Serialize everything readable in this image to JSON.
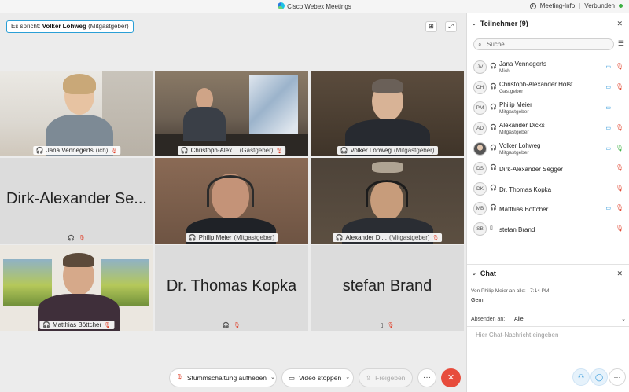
{
  "app": {
    "title": "Cisco Webex Meetings",
    "meeting_info": "Meeting-Info",
    "status": "Verbunden"
  },
  "stage": {
    "speaker_prefix": "Es spricht:",
    "speaker_name": "Volker Lohweg",
    "speaker_role": "(Mitgastgeber)"
  },
  "tiles": [
    {
      "name": "Jana Vennegerts",
      "role": "(ich)"
    },
    {
      "name": "Christoph-Alex...",
      "role": "(Gastgeber)"
    },
    {
      "name": "Volker Lohweg",
      "role": "(Mitgastgeber)"
    },
    {
      "big_name": "Dirk-Alexander Se..."
    },
    {
      "name": "Philip Meier",
      "role": "(Mitgastgeber)"
    },
    {
      "name": "Alexander Di...",
      "role": "(Mitgastgeber)"
    },
    {
      "name": "Matthias Böttcher",
      "role": ""
    },
    {
      "big_name": "Dr. Thomas Kopka"
    },
    {
      "big_name": "stefan Brand"
    }
  ],
  "controls": {
    "mute_label": "Stummschaltung aufheben",
    "video_label": "Video stoppen",
    "share_label": "Freigeben",
    "more_glyph": "···",
    "end_glyph": "✕"
  },
  "participants_panel": {
    "title": "Teilnehmer (9)",
    "search_placeholder": "Suche",
    "items": [
      {
        "initials": "JV",
        "name": "Jana Vennegerts",
        "role": "Mich",
        "video": true,
        "mic": "muted"
      },
      {
        "initials": "CH",
        "name": "Christoph-Alexander Holst",
        "role": "Gastgeber",
        "video": true,
        "mic": "muted"
      },
      {
        "initials": "PM",
        "name": "Philip Meier",
        "role": "Mitgastgeber",
        "video": true,
        "mic": "none"
      },
      {
        "initials": "AD",
        "name": "Alexander Dicks",
        "role": "Mitgastgeber",
        "video": true,
        "mic": "muted"
      },
      {
        "initials": "",
        "name": "Volker Lohweg",
        "role": "Mitgastgeber",
        "video": true,
        "mic": "on"
      },
      {
        "initials": "DS",
        "name": "Dirk-Alexander Segger",
        "role": "",
        "video": false,
        "mic": "muted"
      },
      {
        "initials": "DK",
        "name": "Dr. Thomas Kopka",
        "role": "",
        "video": false,
        "mic": "muted"
      },
      {
        "initials": "MB",
        "name": "Matthias Böttcher",
        "role": "",
        "video": true,
        "mic": "muted"
      },
      {
        "initials": "SB",
        "name": "stefan Brand",
        "role": "",
        "video": false,
        "mic": "muted"
      }
    ]
  },
  "chat": {
    "title": "Chat",
    "from": "Von Philip Meier an alle:",
    "time": "7:14  PM",
    "message": "Gern!",
    "send_to_label": "Absenden an:",
    "send_to_value": "Alle",
    "input_placeholder": "Hier Chat-Nachricht eingeben"
  },
  "colors": {
    "accent": "#2a9fd6",
    "mute_red": "#e0412b",
    "end_red": "#e74c3c",
    "connected_green": "#3cb043"
  }
}
